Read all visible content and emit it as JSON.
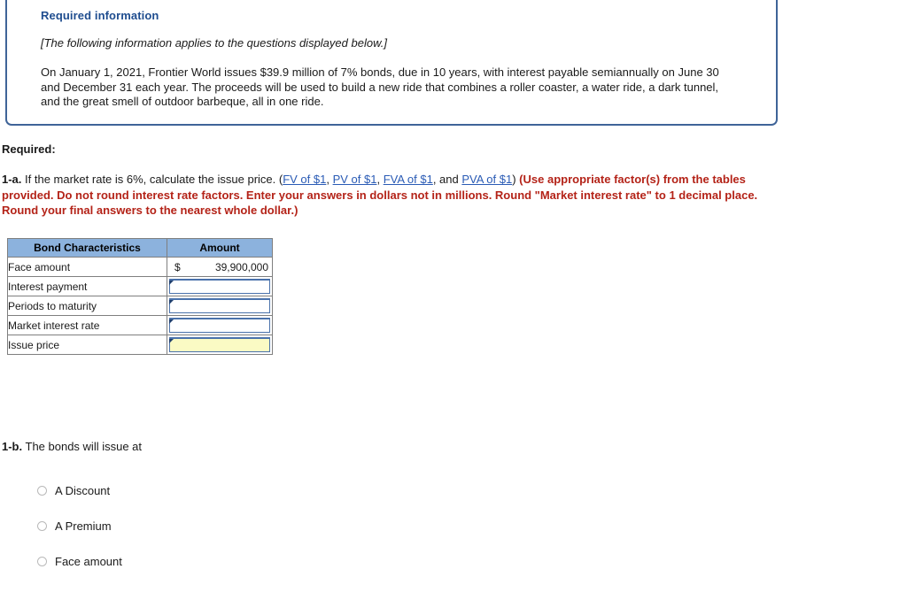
{
  "info_panel": {
    "icon": "info-circle-icon",
    "title": "Required information",
    "applies_note": "[The following information applies to the questions displayed below.]",
    "body": "On January 1, 2021, Frontier World issues $39.9 million of 7% bonds, due in 10 years, with interest payable semiannually on June 30 and December 31 each year. The proceeds will be used to build a new ride that combines a roller coaster, a water ride, a dark tunnel, and the great smell of outdoor barbeque, all in one ride.",
    "border_color": "#3f6498",
    "title_color": "#1f4d8f"
  },
  "required": {
    "label": "Required:"
  },
  "question_1a": {
    "number": "1-a.",
    "text_before_links": " If the market rate is 6%, calculate the issue price. (",
    "links": [
      {
        "label": "FV of $1",
        "sep": ", "
      },
      {
        "label": "PV of $1",
        "sep": ", "
      },
      {
        "label": "FVA of $1",
        "sep": ", and "
      },
      {
        "label": "PVA of $1",
        "sep": ") "
      }
    ],
    "red_instruction": "(Use appropriate factor(s) from the tables provided. Do not round interest rate factors. Enter your answers in dollars not in millions. Round \"Market interest rate\" to 1 decimal place. Round your final answers to the nearest whole dollar.)",
    "link_color": "#2a5bb5",
    "red_color": "#b42318"
  },
  "bond_table": {
    "header_bg": "#8cb2dd",
    "highlight_bg": "#fafac4",
    "input_border": "#4a72ab",
    "columns": [
      "Bond Characteristics",
      "Amount"
    ],
    "rows": [
      {
        "label": "Face amount",
        "type": "value",
        "currency": "$",
        "value": "39,900,000"
      },
      {
        "label": "Interest payment",
        "type": "input",
        "value": "",
        "highlight": false
      },
      {
        "label": "Periods to maturity",
        "type": "input",
        "value": "",
        "highlight": false
      },
      {
        "label": "Market interest rate",
        "type": "input",
        "value": "",
        "highlight": false
      },
      {
        "label": "Issue price",
        "type": "input",
        "value": "",
        "highlight": true
      }
    ]
  },
  "question_1b": {
    "number": "1-b.",
    "text": " The bonds will issue at",
    "options": [
      {
        "label": "A Discount",
        "selected": false
      },
      {
        "label": "A Premium",
        "selected": false
      },
      {
        "label": "Face amount",
        "selected": false
      }
    ]
  }
}
